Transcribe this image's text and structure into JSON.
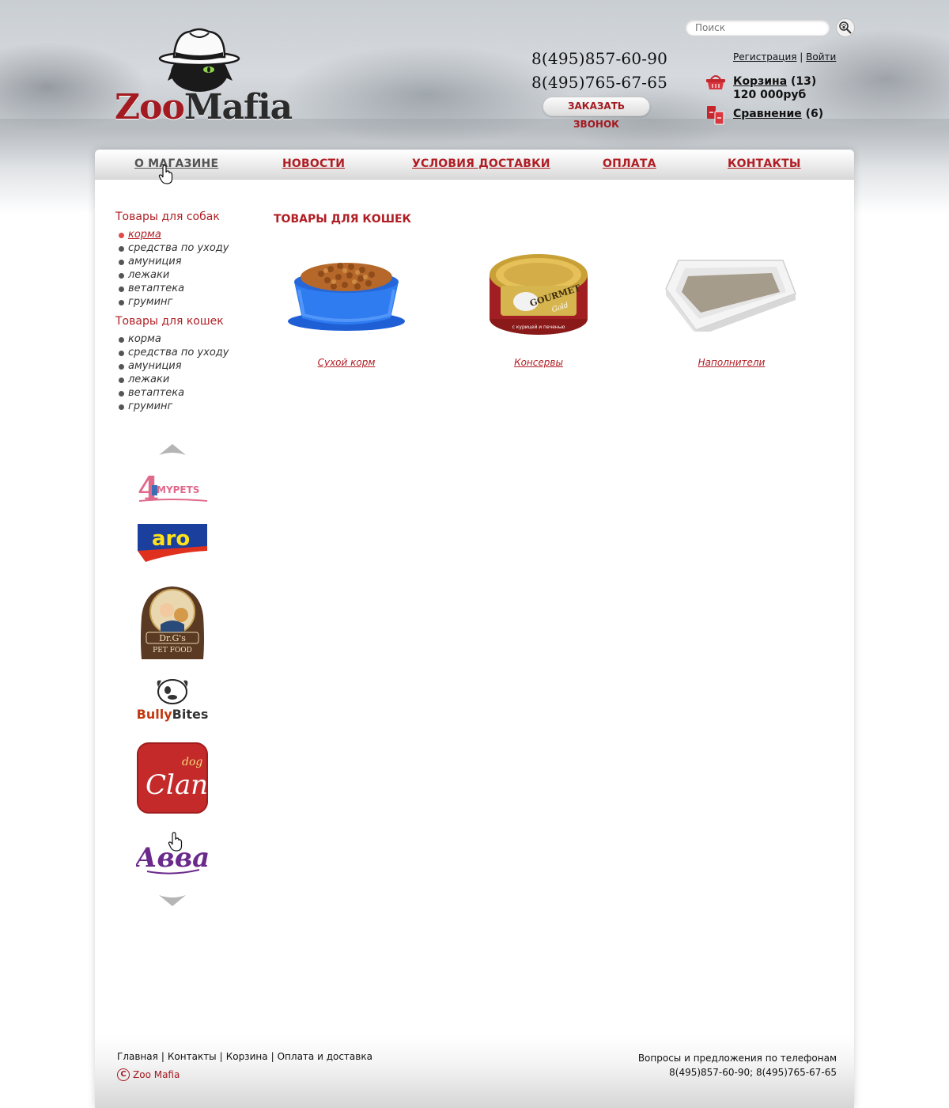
{
  "header": {
    "logo_text_zoo": "Zoo",
    "logo_text_mafia": "Mafia",
    "search_placeholder": "Поиск",
    "phones": [
      "8(495)857-60-90",
      "8(495)765-67-65"
    ],
    "callback_label": "ЗАКАЗАТЬ ЗВОНОК",
    "auth": {
      "register": "Регистрация",
      "separator": "|",
      "login": "Войти"
    },
    "cart": {
      "label": "Корзина",
      "count": "(13)",
      "total": "120 000руб"
    },
    "compare": {
      "label": "Сравнение",
      "count": "(6)"
    }
  },
  "nav": {
    "items": [
      {
        "label": "О МАГАЗИНЕ",
        "active": true
      },
      {
        "label": "НОВОСТИ",
        "active": false
      },
      {
        "label": "УСЛОВИЯ ДОСТАВКИ",
        "active": false
      },
      {
        "label": "ОПЛАТА",
        "active": false
      },
      {
        "label": "КОНТАКТЫ",
        "active": false
      }
    ]
  },
  "sidebar": {
    "dogs": {
      "title": "Товары для собак",
      "items": [
        "корма",
        "средства по уходу",
        "амуниция",
        "лежаки",
        "ветаптека",
        "груминг"
      ],
      "active_index": 0
    },
    "cats": {
      "title": "Товары для кошек",
      "items": [
        "корма",
        "средства по уходу",
        "амуниция",
        "лежаки",
        "ветаптека",
        "груминг"
      ]
    },
    "brands": [
      "4MYPETS",
      "aro",
      "Dr.G's Fresh Pet Food",
      "Bully Bites",
      "dog Clan",
      "Авва"
    ]
  },
  "content": {
    "title": "ТОВАРЫ ДЛЯ КОШЕК",
    "products": [
      {
        "label": "Сухой корм",
        "image": "blue-bowl-dry-food"
      },
      {
        "label": "Консервы",
        "image": "gourmet-gold-can"
      },
      {
        "label": "Наполнители",
        "image": "cat-litter-tray"
      }
    ],
    "can_brand": "GOURMET",
    "can_sub": "Gold",
    "can_flavor": "с курицей и печенью"
  },
  "footer": {
    "links": [
      "Главная",
      "Контакты",
      "Корзина",
      "Оплата и доставка"
    ],
    "copyright": "Zoo Mafia",
    "contact_text": "Вопросы и предложения по телефонам",
    "contact_phones": "8(495)857-60-90; 8(495)765-67-65"
  },
  "colors": {
    "accent": "#b01e24",
    "text": "#111111",
    "nav_active": "#555555"
  }
}
